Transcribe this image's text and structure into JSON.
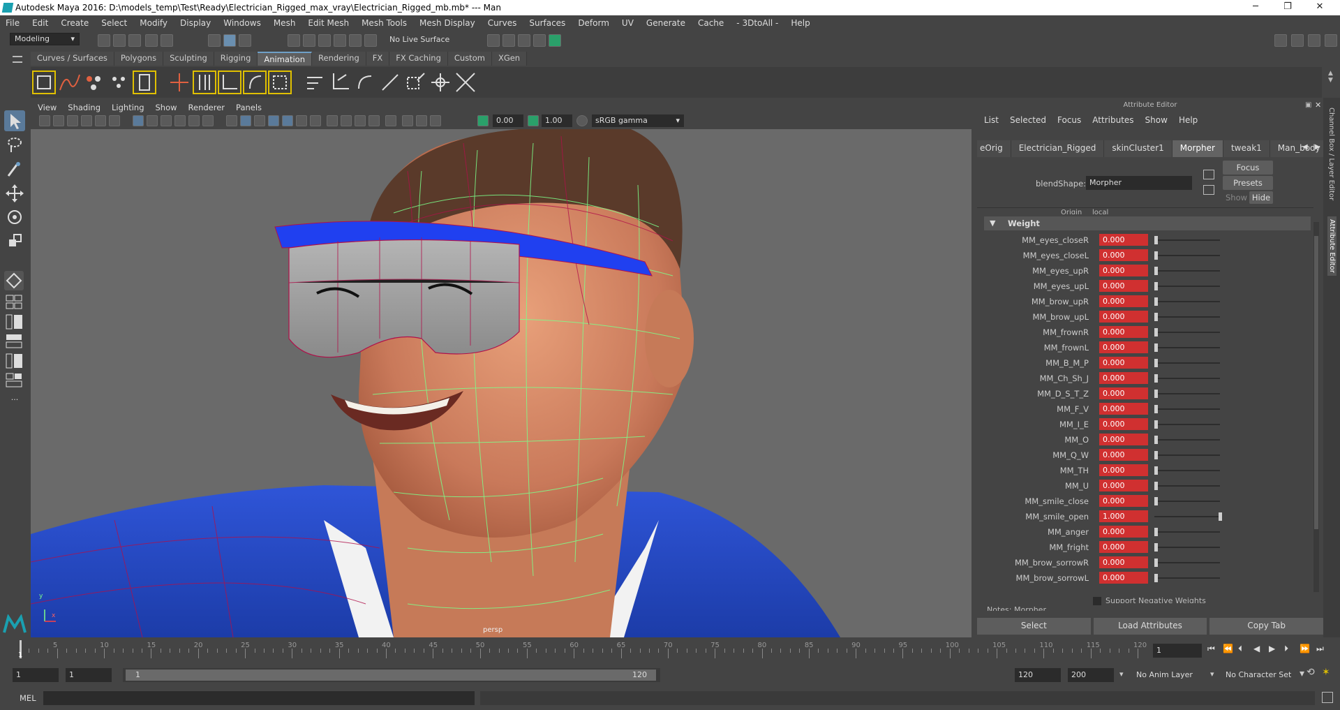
{
  "window": {
    "title": "Autodesk Maya 2016: D:\\models_temp\\Test\\Ready\\Electrician_Rigged_max_vray\\Electrician_Rigged_mb.mb*   ---   Man",
    "minimize": "─",
    "maximize": "❐",
    "close": "✕"
  },
  "menubar": [
    "File",
    "Edit",
    "Create",
    "Select",
    "Modify",
    "Display",
    "Windows",
    "Mesh",
    "Edit Mesh",
    "Mesh Tools",
    "Mesh Display",
    "Curves",
    "Surfaces",
    "Deform",
    "UV",
    "Generate",
    "Cache",
    "- 3DtoAll -",
    "Help"
  ],
  "statusline": {
    "mode": "Modeling",
    "live_surface": "No Live Surface"
  },
  "shelf": {
    "tabs": [
      "Curves / Surfaces",
      "Polygons",
      "Sculpting",
      "Rigging",
      "Animation",
      "Rendering",
      "FX",
      "FX Caching",
      "Custom",
      "XGen"
    ],
    "active_tab": "Animation"
  },
  "viewport": {
    "menu": [
      "View",
      "Shading",
      "Lighting",
      "Show",
      "Renderer",
      "Panels"
    ],
    "exposure": "0.00",
    "gamma": "1.00",
    "color_space": "sRGB gamma",
    "camera_label": "persp",
    "axis_y": "y",
    "axis_x": "x"
  },
  "attribute_editor": {
    "title": "Attribute Editor",
    "menu": [
      "List",
      "Selected",
      "Focus",
      "Attributes",
      "Show",
      "Help"
    ],
    "tabs": [
      "eOrig",
      "Electrician_Rigged",
      "skinCluster1",
      "Morpher",
      "tweak1",
      "Man_body"
    ],
    "active_tab": "Morpher",
    "blendshape_label": "blendShape:",
    "blendshape_value": "Morpher",
    "focus_btn": "Focus",
    "presets_btn": "Presets",
    "show_btn": "Show",
    "hide_btn": "Hide",
    "origin_label": "Origin",
    "origin_value": "local",
    "section": "Weight",
    "weights": [
      {
        "name": "MM_eyes_closeR",
        "value": "0.000",
        "level": 0
      },
      {
        "name": "MM_eyes_closeL",
        "value": "0.000",
        "level": 0
      },
      {
        "name": "MM_eyes_upR",
        "value": "0.000",
        "level": 0
      },
      {
        "name": "MM_eyes_upL",
        "value": "0.000",
        "level": 0
      },
      {
        "name": "MM_brow_upR",
        "value": "0.000",
        "level": 0
      },
      {
        "name": "MM_brow_upL",
        "value": "0.000",
        "level": 0
      },
      {
        "name": "MM_frownR",
        "value": "0.000",
        "level": 0
      },
      {
        "name": "MM_frownL",
        "value": "0.000",
        "level": 0
      },
      {
        "name": "MM_B_M_P",
        "value": "0.000",
        "level": 0
      },
      {
        "name": "MM_Ch_Sh_J",
        "value": "0.000",
        "level": 0
      },
      {
        "name": "MM_D_S_T_Z",
        "value": "0.000",
        "level": 0
      },
      {
        "name": "MM_F_V",
        "value": "0.000",
        "level": 0
      },
      {
        "name": "MM_I_E",
        "value": "0.000",
        "level": 0
      },
      {
        "name": "MM_O",
        "value": "0.000",
        "level": 0
      },
      {
        "name": "MM_Q_W",
        "value": "0.000",
        "level": 0
      },
      {
        "name": "MM_TH",
        "value": "0.000",
        "level": 0
      },
      {
        "name": "MM_U",
        "value": "0.000",
        "level": 0
      },
      {
        "name": "MM_smile_close",
        "value": "0.000",
        "level": 0
      },
      {
        "name": "MM_smile_open",
        "value": "1.000",
        "level": 1
      },
      {
        "name": "MM_anger",
        "value": "0.000",
        "level": 0
      },
      {
        "name": "MM_fright",
        "value": "0.000",
        "level": 0
      },
      {
        "name": "MM_brow_sorrowR",
        "value": "0.000",
        "level": 0
      },
      {
        "name": "MM_brow_sorrowL",
        "value": "0.000",
        "level": 0
      }
    ],
    "support_negative": "Support Negative Weights",
    "notes": "Notes: Morpher",
    "buttons": [
      "Select",
      "Load Attributes",
      "Copy Tab"
    ]
  },
  "right_sidebar": {
    "channel_box": "Channel Box / Layer Editor",
    "attr_editor": "Attribute Editor"
  },
  "timeline": {
    "ticks": [
      "1",
      "5",
      "10",
      "15",
      "20",
      "25",
      "30",
      "35",
      "40",
      "45",
      "50",
      "55",
      "60",
      "65",
      "70",
      "75",
      "80",
      "85",
      "90",
      "95",
      "100",
      "105",
      "110",
      "115",
      "120"
    ],
    "current_frame": "1",
    "current_frame_field": "1"
  },
  "range": {
    "start": "1",
    "playback_start": "1",
    "slider_start": "1",
    "slider_end": "120",
    "playback_end": "120",
    "end": "200",
    "anim_layer": "No Anim Layer",
    "character_set": "No Character Set"
  },
  "command_line": {
    "lang": "MEL"
  },
  "colors": {
    "accent": "#6fa0c8",
    "weight_field": "#d03030",
    "wire_green": "#7dff8a",
    "wire_red": "#b0104a"
  }
}
